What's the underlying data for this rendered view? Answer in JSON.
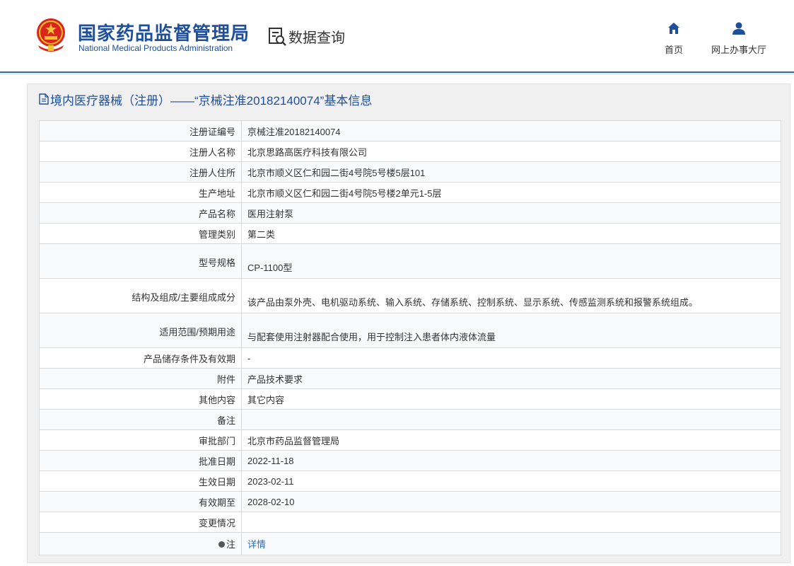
{
  "header": {
    "org_cn": "国家药品监督管理局",
    "org_en": "National Medical Products Administration",
    "section_title": "数据查询",
    "nav": [
      {
        "label": "首页",
        "icon": "home-icon"
      },
      {
        "label": "网上办事大厅",
        "icon": "user-icon"
      }
    ]
  },
  "colors": {
    "brand": "#1f4f9a",
    "link": "#2a6cb6"
  },
  "page": {
    "title": "境内医疗器械（注册）——“京械注准20182140074”基本信息"
  },
  "rows": [
    {
      "key": "注册证编号",
      "value": "京械注准20182140074"
    },
    {
      "key": "注册人名称",
      "value": "北京思路高医疗科技有限公司"
    },
    {
      "key": "注册人住所",
      "value": "北京市顺义区仁和园二街4号院5号楼5层101"
    },
    {
      "key": "生产地址",
      "value": "北京市顺义区仁和园二街4号院5号楼2单元1-5层"
    },
    {
      "key": "产品名称",
      "value": "医用注射泵"
    },
    {
      "key": "管理类别",
      "value": "第二类"
    },
    {
      "key": "型号规格",
      "value": "CP-1100型"
    },
    {
      "key": "结构及组成/主要组成成分",
      "value": "该产品由泵外壳、电机驱动系统、输入系统、存储系统、控制系统、显示系统、传感监测系统和报警系统组成。"
    },
    {
      "key": "适用范围/预期用途",
      "value": "与配套使用注射器配合使用，用于控制注入患者体内液体流量"
    },
    {
      "key": "产品储存条件及有效期",
      "value": "-"
    },
    {
      "key": "附件",
      "value": "产品技术要求"
    },
    {
      "key": "其他内容",
      "value": "其它内容"
    },
    {
      "key": "备注",
      "value": ""
    },
    {
      "key": "审批部门",
      "value": "北京市药品监督管理局"
    },
    {
      "key": "批准日期",
      "value": "2022-11-18"
    },
    {
      "key": "生效日期",
      "value": "2023-02-11"
    },
    {
      "key": "有效期至",
      "value": "2028-02-10"
    },
    {
      "key": "变更情况",
      "value": ""
    }
  ],
  "note": {
    "key": "注",
    "value": "详情"
  }
}
